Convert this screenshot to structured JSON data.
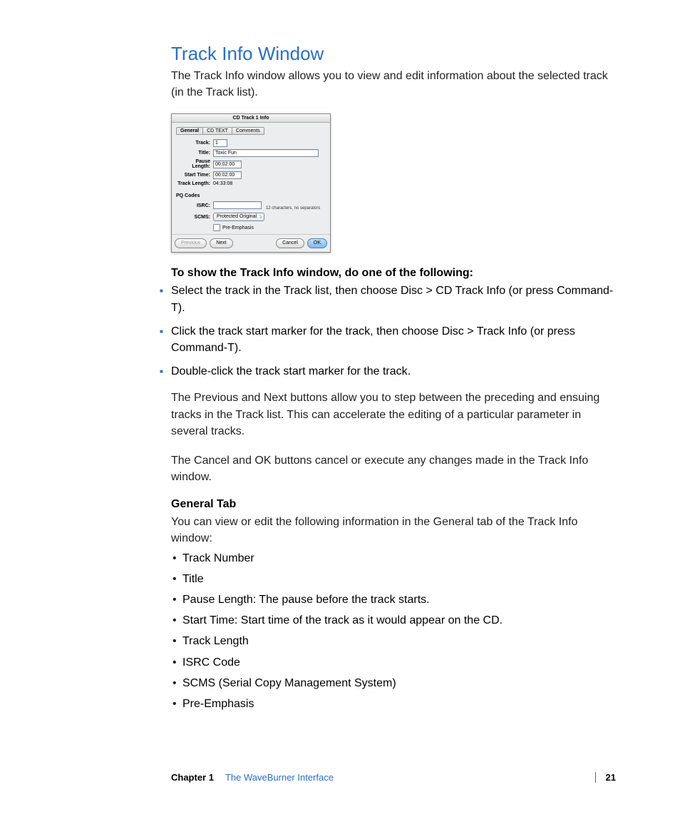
{
  "heading": "Track Info Window",
  "intro": "The Track Info window allows you to view and edit information about the selected track (in the Track list).",
  "dialog": {
    "title": "CD Track 1 Info",
    "tabs": [
      "General",
      "CD TEXT",
      "Comments"
    ],
    "fields": {
      "track_label": "Track:",
      "track_value": "1",
      "title_label": "Title:",
      "title_value": "Toxic Fun",
      "pause_label": "Pause Length:",
      "pause_value": "00:02:00",
      "start_label": "Start Time:",
      "start_value": "00:02:00",
      "length_label": "Track Length:",
      "length_value": "04:33:08"
    },
    "pq_section": "PQ Codes",
    "isrc_label": "ISRC:",
    "isrc_hint": "12 characters, no separators",
    "scms_label": "SCMS:",
    "scms_value": "Protected Original",
    "preemph_label": "Pre-Emphasis",
    "buttons": {
      "previous": "Previous",
      "next": "Next",
      "cancel": "Cancel",
      "ok": "OK"
    }
  },
  "howto_lead": "To show the Track Info window, do one of the following:",
  "howto_items": [
    "Select the track in the Track list, then choose Disc > CD Track Info (or press Command-T).",
    "Click the track start marker for the track, then choose Disc > Track Info (or press Command-T).",
    "Double-click the track start marker for the track."
  ],
  "para_prevnext": "The Previous and Next buttons allow you to step between the preceding and ensuing tracks in the Track list. This can accelerate the editing of a particular parameter in several tracks.",
  "para_cancelok": "The Cancel and OK buttons cancel or execute any changes made in the Track Info window.",
  "general_tab_head": "General Tab",
  "general_tab_intro": "You can view or edit the following information in the General tab of the Track Info window:",
  "general_tab_items": [
    "Track Number",
    "Title",
    "Pause Length:  The pause before the track starts.",
    "Start Time:  Start time of the track as it would appear on the CD.",
    "Track Length",
    "ISRC Code",
    "SCMS (Serial Copy Management System)",
    "Pre-Emphasis"
  ],
  "footer": {
    "chapter_label": "Chapter 1",
    "chapter_name": "The WaveBurner Interface",
    "page_number": "21"
  }
}
